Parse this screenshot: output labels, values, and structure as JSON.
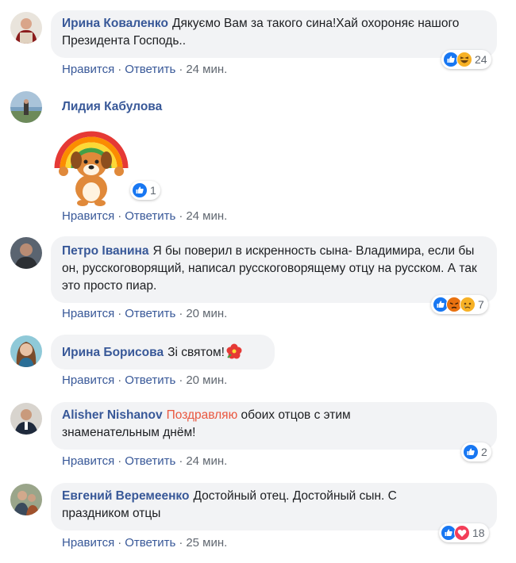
{
  "actions": {
    "like": "Нравится",
    "reply": "Ответить",
    "sep": "·"
  },
  "colors": {
    "name": "#385898",
    "bubble": "#f2f3f5",
    "meta": "#606770",
    "link": "#e9573f"
  },
  "comments": [
    {
      "author": "Ирина Коваленко",
      "text": "Дякуємо Вам за такого сина!Хай охороняє нашого Президента Господь..",
      "time": "24 мин.",
      "reactions": [
        "like-icon",
        "haha-icon"
      ],
      "reaction_count": "24"
    },
    {
      "author": "Лидия Кабулова",
      "sticker": "rainbow-dog-sticker",
      "time": "24 мин.",
      "reactions": [
        "like-icon"
      ],
      "reaction_count": "1"
    },
    {
      "author": "Петро Іванина",
      "text": "Я бы поверил в искренность сына- Владимира, если бы он, русскоговорящий, написал русскоговорящему отцу на русском. А так это просто пиар.",
      "time": "20 мин.",
      "reactions": [
        "like-icon",
        "angry-icon",
        "sad-icon"
      ],
      "reaction_count": "7"
    },
    {
      "author": "Ирина Борисова",
      "text": "Зі святом!",
      "emoji": "hibiscus-emoji",
      "time": "20 мин."
    },
    {
      "author": "Alisher Nishanov",
      "link_text": "Поздравляю",
      "text": " обоих отцов с этим знаменательным днём!",
      "time": "24 мин.",
      "reactions": [
        "like-icon"
      ],
      "reaction_count": "2"
    },
    {
      "author": "Евгений Веремеенко",
      "text": "Достойный отец. Достойный сын. С праздником отцы",
      "time": "25 мин.",
      "reactions": [
        "like-icon",
        "love-icon"
      ],
      "reaction_count": "18"
    }
  ]
}
